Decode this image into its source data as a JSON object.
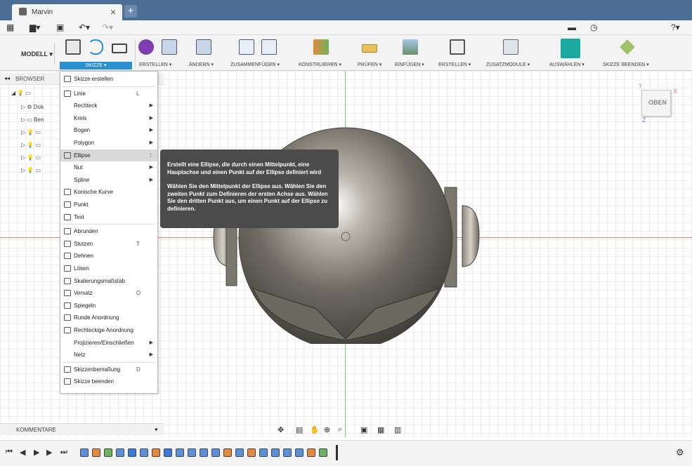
{
  "tab": {
    "title": "Marvin",
    "close": "×",
    "new": "+"
  },
  "ribbon": {
    "modell": "MODELL ▾",
    "groups": [
      "SKIZZE ▾",
      "ERSTELLEN ▾",
      "ÄNDERN ▾",
      "ZUSAMMENFÜGEN ▾",
      "KONSTRUIEREN ▾",
      "PRÜFEN ▾",
      "EINFÜGEN ▾",
      "ERSTELLEN ▾",
      "ZUSATZMODULE ▾",
      "AUSWÄHLEN ▾",
      "SKIZZE BEENDEN ▾"
    ]
  },
  "browser": {
    "title": "BROWSER",
    "items": [
      "Dok",
      "Ben"
    ]
  },
  "menu": {
    "items": [
      {
        "label": "Skizze erstellen"
      },
      {
        "label": "Linie",
        "shortcut": "L"
      },
      {
        "label": "Rechteck",
        "arrow": "▶"
      },
      {
        "label": "Kreis",
        "arrow": "▶"
      },
      {
        "label": "Bogen",
        "arrow": "▶"
      },
      {
        "label": "Polygon",
        "arrow": "▶"
      },
      {
        "label": "Ellipse",
        "arrow": "⋮"
      },
      {
        "label": "Nut",
        "arrow": "▶"
      },
      {
        "label": "Spline",
        "arrow": "▶"
      },
      {
        "label": "Konische Kurve"
      },
      {
        "label": "Punkt"
      },
      {
        "label": "Text"
      },
      {
        "label": "Abrunden"
      },
      {
        "label": "Stutzen",
        "shortcut": "T"
      },
      {
        "label": "Dehnen"
      },
      {
        "label": "Lösen"
      },
      {
        "label": "Skalierungsmaßstab"
      },
      {
        "label": "Versatz",
        "shortcut": "O"
      },
      {
        "label": "Spiegeln"
      },
      {
        "label": "Runde Anordnung"
      },
      {
        "label": "Rechteckige Anordnung"
      },
      {
        "label": "Projizieren/Einschließen",
        "arrow": "▶"
      },
      {
        "label": "Netz",
        "arrow": "▶"
      },
      {
        "label": "Skizzenbemaßung",
        "shortcut": "D"
      },
      {
        "label": "Skizze beenden"
      }
    ]
  },
  "tooltip": {
    "line1": "Erstellt eine Ellipse, die durch einen Mittelpunkt, eine Hauptachse und einen Punkt auf der Ellipse definiert wird",
    "line2": "Wählen Sie den Mittelpunkt der Ellipse aus. Wählen Sie den zweiten Punkt zum Definieren der ersten Achse aus. Wählen Sie den dritten Punkt aus, um einen Punkt auf der Ellipse zu definieren."
  },
  "viewcube": {
    "label": "OBEN",
    "x": "X",
    "y": "Y",
    "z": "Z"
  },
  "comments": {
    "title": "KOMMENTARE"
  },
  "colors": {
    "titlebar": "#4c6d94",
    "accent": "#2a8fd1",
    "tooltip": "#4b4b4b"
  }
}
